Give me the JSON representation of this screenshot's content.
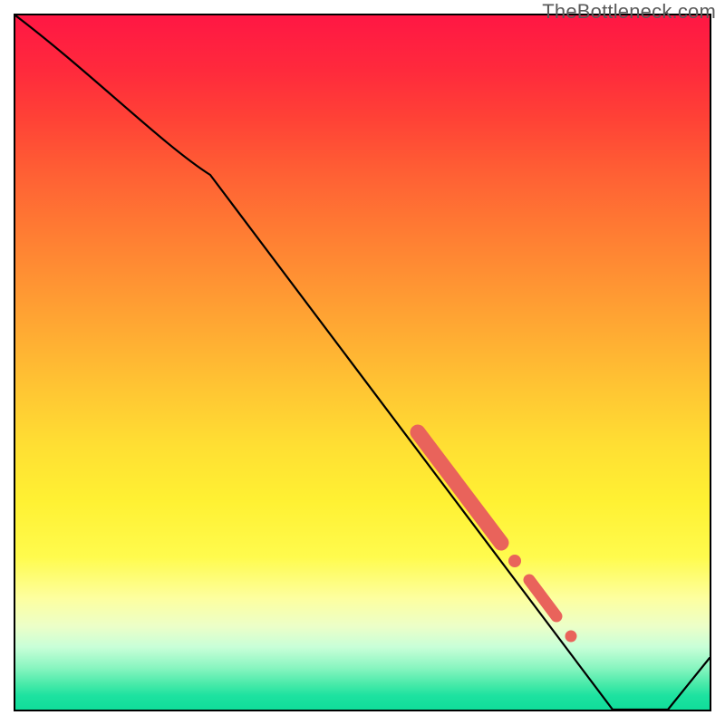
{
  "watermark": "TheBottleneck.com",
  "chart_data": {
    "type": "line",
    "x": [
      0.0,
      0.28,
      0.86,
      0.94,
      1.0
    ],
    "y": [
      1.0,
      0.77,
      0.0,
      0.0,
      0.075
    ],
    "title": "",
    "xlabel": "",
    "ylabel": "",
    "xlim": [
      0,
      1
    ],
    "ylim": [
      0,
      1
    ],
    "series": [
      {
        "name": "curve",
        "x": [
          0.0,
          0.28,
          0.86,
          0.94,
          1.0
        ],
        "y": [
          1.0,
          0.77,
          0.0,
          0.0,
          0.075
        ]
      }
    ],
    "highlights": [
      {
        "x0": 0.58,
        "y0": 0.4,
        "x1": 0.7,
        "y1": 0.24,
        "weight": "heavy"
      },
      {
        "x0": 0.715,
        "y0": 0.22,
        "x1": 0.725,
        "y1": 0.205,
        "weight": "dot"
      },
      {
        "x0": 0.74,
        "y0": 0.185,
        "x1": 0.78,
        "y1": 0.132,
        "weight": "medium"
      },
      {
        "x0": 0.8,
        "y0": 0.105,
        "x1": 0.81,
        "y1": 0.092,
        "weight": "dot"
      }
    ],
    "background_gradient": {
      "top": "#ff1744",
      "mid": "#ffd633",
      "bottom": "#10dd9a"
    }
  }
}
